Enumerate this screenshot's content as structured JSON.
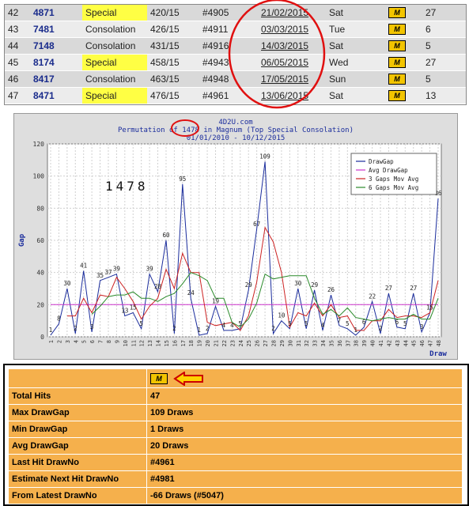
{
  "hits_table": {
    "rows": [
      {
        "idx": "42",
        "number": "4871",
        "prize": "Special",
        "ratio": "420/15",
        "draw": "#4905",
        "date": "21/02/2015",
        "day": "Sat",
        "count": "27"
      },
      {
        "idx": "43",
        "number": "7481",
        "prize": "Consolation",
        "ratio": "426/15",
        "draw": "#4911",
        "date": "03/03/2015",
        "day": "Tue",
        "count": "6"
      },
      {
        "idx": "44",
        "number": "7148",
        "prize": "Consolation",
        "ratio": "431/15",
        "draw": "#4916",
        "date": "14/03/2015",
        "day": "Sat",
        "count": "5"
      },
      {
        "idx": "45",
        "number": "8174",
        "prize": "Special",
        "ratio": "458/15",
        "draw": "#4943",
        "date": "06/05/2015",
        "day": "Wed",
        "count": "27"
      },
      {
        "idx": "46",
        "number": "8417",
        "prize": "Consolation",
        "ratio": "463/15",
        "draw": "#4948",
        "date": "17/05/2015",
        "day": "Sun",
        "count": "5"
      },
      {
        "idx": "47",
        "number": "8471",
        "prize": "Special",
        "ratio": "476/15",
        "draw": "#4961",
        "date": "13/06/2015",
        "day": "Sat",
        "count": "13"
      }
    ],
    "logo_text": "M",
    "special_color": "#ffff44"
  },
  "chart_data": {
    "type": "line",
    "site": "4D2U.com",
    "title": "Permutation of 1478 in Magnum (Top Special Consolation)",
    "subtitle": "01/01/2010 - 10/12/2015",
    "big_label": "1478",
    "xlabel": "Draw",
    "ylabel": "Gap",
    "ylim": [
      0,
      120
    ],
    "yticks": [
      0,
      20,
      40,
      60,
      80,
      100,
      120
    ],
    "x": [
      1,
      2,
      3,
      4,
      5,
      6,
      7,
      8,
      9,
      10,
      11,
      12,
      13,
      14,
      15,
      16,
      17,
      18,
      19,
      20,
      21,
      22,
      23,
      24,
      25,
      26,
      27,
      28,
      29,
      30,
      31,
      32,
      33,
      34,
      35,
      36,
      37,
      38,
      39,
      40,
      41,
      42,
      43,
      44,
      45,
      46,
      47,
      48
    ],
    "series": [
      {
        "name": "DrawGap",
        "color": "#1a2c9c",
        "values": [
          1,
          8,
          30,
          2,
          41,
          3,
          35,
          37,
          39,
          13,
          15,
          5,
          39,
          28,
          60,
          2,
          95,
          24,
          1,
          2,
          19,
          4,
          4,
          5,
          29,
          67,
          109,
          2,
          10,
          5,
          30,
          5,
          29,
          4,
          26,
          7,
          5,
          1,
          6,
          22,
          2,
          27,
          6,
          5,
          27,
          3,
          15,
          86
        ]
      },
      {
        "name": "Avg DrawGap",
        "color": "#cc33cc",
        "values": [
          20,
          20,
          20,
          20,
          20,
          20,
          20,
          20,
          20,
          20,
          20,
          20,
          20,
          20,
          20,
          20,
          20,
          20,
          20,
          20,
          20,
          20,
          20,
          20,
          20,
          20,
          20,
          20,
          20,
          20,
          20,
          20,
          20,
          20,
          20,
          20,
          20,
          20,
          20,
          20,
          20,
          20,
          20,
          20,
          20,
          20,
          20,
          20
        ]
      },
      {
        "name": "3 Gaps Mov Avg",
        "color": "#cc2222",
        "values": [
          null,
          null,
          13,
          13,
          24,
          15,
          26,
          25,
          37,
          30,
          22,
          11,
          19,
          24,
          42,
          30,
          52,
          40,
          40,
          9,
          7,
          8,
          9,
          4,
          13,
          34,
          68,
          59,
          40,
          6,
          15,
          13,
          21,
          13,
          20,
          12,
          13,
          4,
          4,
          10,
          10,
          17,
          12,
          13,
          13,
          12,
          15,
          35
        ]
      },
      {
        "name": "6 Gaps Mov Avg",
        "color": "#2a8a2a",
        "values": [
          null,
          null,
          null,
          null,
          null,
          14,
          19,
          25,
          26,
          26,
          28,
          24,
          24,
          22,
          25,
          27,
          33,
          40,
          38,
          35,
          24,
          24,
          9,
          6,
          11,
          21,
          39,
          36,
          37,
          38,
          38,
          38,
          24,
          14,
          17,
          13,
          18,
          12,
          11,
          10,
          11,
          12,
          11,
          11,
          14,
          11,
          11,
          24
        ]
      }
    ],
    "data_labels": [
      {
        "x": 1,
        "y": 1,
        "text": "1"
      },
      {
        "x": 2,
        "y": 8,
        "text": "8"
      },
      {
        "x": 3,
        "y": 30,
        "text": "30"
      },
      {
        "x": 4,
        "y": 2,
        "text": "2"
      },
      {
        "x": 5,
        "y": 41,
        "text": "41"
      },
      {
        "x": 6,
        "y": 3,
        "text": "3"
      },
      {
        "x": 7,
        "y": 35,
        "text": "35"
      },
      {
        "x": 8,
        "y": 37,
        "text": "37"
      },
      {
        "x": 9,
        "y": 39,
        "text": "39"
      },
      {
        "x": 10,
        "y": 13,
        "text": "13"
      },
      {
        "x": 11,
        "y": 15,
        "text": "15"
      },
      {
        "x": 12,
        "y": 5,
        "text": "5"
      },
      {
        "x": 13,
        "y": 39,
        "text": "39"
      },
      {
        "x": 14,
        "y": 28,
        "text": "28"
      },
      {
        "x": 15,
        "y": 60,
        "text": "60"
      },
      {
        "x": 16,
        "y": 2,
        "text": "2"
      },
      {
        "x": 17,
        "y": 95,
        "text": "95"
      },
      {
        "x": 18,
        "y": 24,
        "text": "24"
      },
      {
        "x": 19,
        "y": 1,
        "text": "1"
      },
      {
        "x": 20,
        "y": 2,
        "text": "2"
      },
      {
        "x": 21,
        "y": 19,
        "text": "19"
      },
      {
        "x": 22,
        "y": 4,
        "text": "4"
      },
      {
        "x": 23,
        "y": 4,
        "text": "4"
      },
      {
        "x": 24,
        "y": 5,
        "text": "5"
      },
      {
        "x": 25,
        "y": 29,
        "text": "29"
      },
      {
        "x": 26,
        "y": 67,
        "text": "67"
      },
      {
        "x": 27,
        "y": 109,
        "text": "109"
      },
      {
        "x": 28,
        "y": 2,
        "text": "2"
      },
      {
        "x": 29,
        "y": 10,
        "text": "10"
      },
      {
        "x": 30,
        "y": 5,
        "text": "5"
      },
      {
        "x": 31,
        "y": 30,
        "text": "30"
      },
      {
        "x": 32,
        "y": 5,
        "text": "5"
      },
      {
        "x": 33,
        "y": 29,
        "text": "29"
      },
      {
        "x": 34,
        "y": 4,
        "text": "4"
      },
      {
        "x": 35,
        "y": 26,
        "text": "26"
      },
      {
        "x": 36,
        "y": 7,
        "text": "7"
      },
      {
        "x": 37,
        "y": 5,
        "text": "5"
      },
      {
        "x": 38,
        "y": 1,
        "text": "1"
      },
      {
        "x": 39,
        "y": 6,
        "text": "6"
      },
      {
        "x": 40,
        "y": 22,
        "text": "22"
      },
      {
        "x": 41,
        "y": 2,
        "text": "2"
      },
      {
        "x": 42,
        "y": 27,
        "text": "27"
      },
      {
        "x": 43,
        "y": 6,
        "text": "6"
      },
      {
        "x": 44,
        "y": 5,
        "text": "5"
      },
      {
        "x": 45,
        "y": 27,
        "text": "27"
      },
      {
        "x": 46,
        "y": 3,
        "text": "3"
      },
      {
        "x": 47,
        "y": 15,
        "text": "15"
      },
      {
        "x": 48,
        "y": 86,
        "text": "86"
      }
    ],
    "legend_position": "top-right",
    "grid": true
  },
  "stats": {
    "header_logo_text": "M",
    "arrow_color": "#ffd200",
    "rows": [
      {
        "label": "Total Hits",
        "value": "47"
      },
      {
        "label": "Max DrawGap",
        "value": "109 Draws"
      },
      {
        "label": "Min DrawGap",
        "value": "1 Draws"
      },
      {
        "label": "Avg DrawGap",
        "value": "20 Draws"
      },
      {
        "label": "Last Hit DrawNo",
        "value": "#4961"
      },
      {
        "label": "Estimate Next Hit DrawNo",
        "value": "#4981"
      },
      {
        "label": "From Latest DrawNo",
        "value": "-66 Draws (#5047)"
      }
    ]
  }
}
